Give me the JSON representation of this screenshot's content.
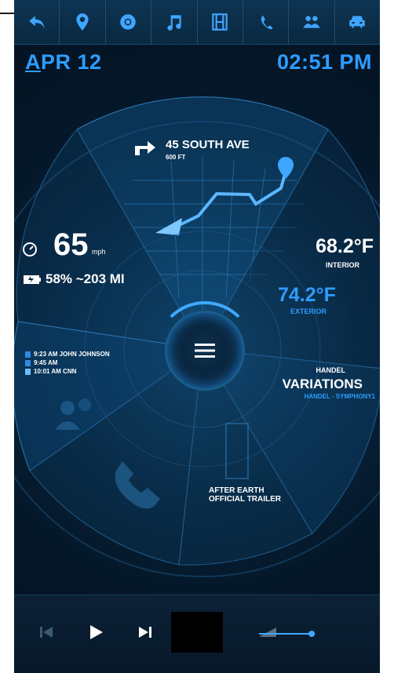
{
  "colors": {
    "accent": "#2e9cff",
    "text": "#ffffff",
    "background": "#05182a"
  },
  "nav": {
    "icons": [
      "back-arrow-icon",
      "location-pin-icon",
      "chrome-icon",
      "music-note-icon",
      "film-icon",
      "phone-icon",
      "contacts-icon",
      "car-icon"
    ]
  },
  "header": {
    "date_prefix": "A",
    "date_rest": "PR 12",
    "time": "02:51 PM"
  },
  "navigation": {
    "street": "45 SOUTH AVE",
    "distance": "600 FT"
  },
  "vehicle": {
    "speed": "65",
    "speed_unit": "mph",
    "battery": "58% ~203 MI"
  },
  "climate": {
    "interior_temp": "68.2°F",
    "interior_label": "INTERIOR",
    "exterior_temp": "74.2°F",
    "exterior_label": "EXTERIOR"
  },
  "social": {
    "items": [
      {
        "icon": "facebook-icon",
        "text": "9:23 AM JOHN JOHNSON"
      },
      {
        "icon": "facebook-icon",
        "text": "9:45 AM"
      },
      {
        "icon": "twitter-icon",
        "text": "10:01 AM CNN"
      }
    ]
  },
  "music": {
    "composer": "HANDEL",
    "title": "VARIATIONS",
    "subtitle": "HANDEL - SYMPHONY1"
  },
  "video": {
    "line1": "AFTER EARTH",
    "line2": "OFFICIAL TRAILER"
  },
  "player": {
    "progress": 0.88
  }
}
